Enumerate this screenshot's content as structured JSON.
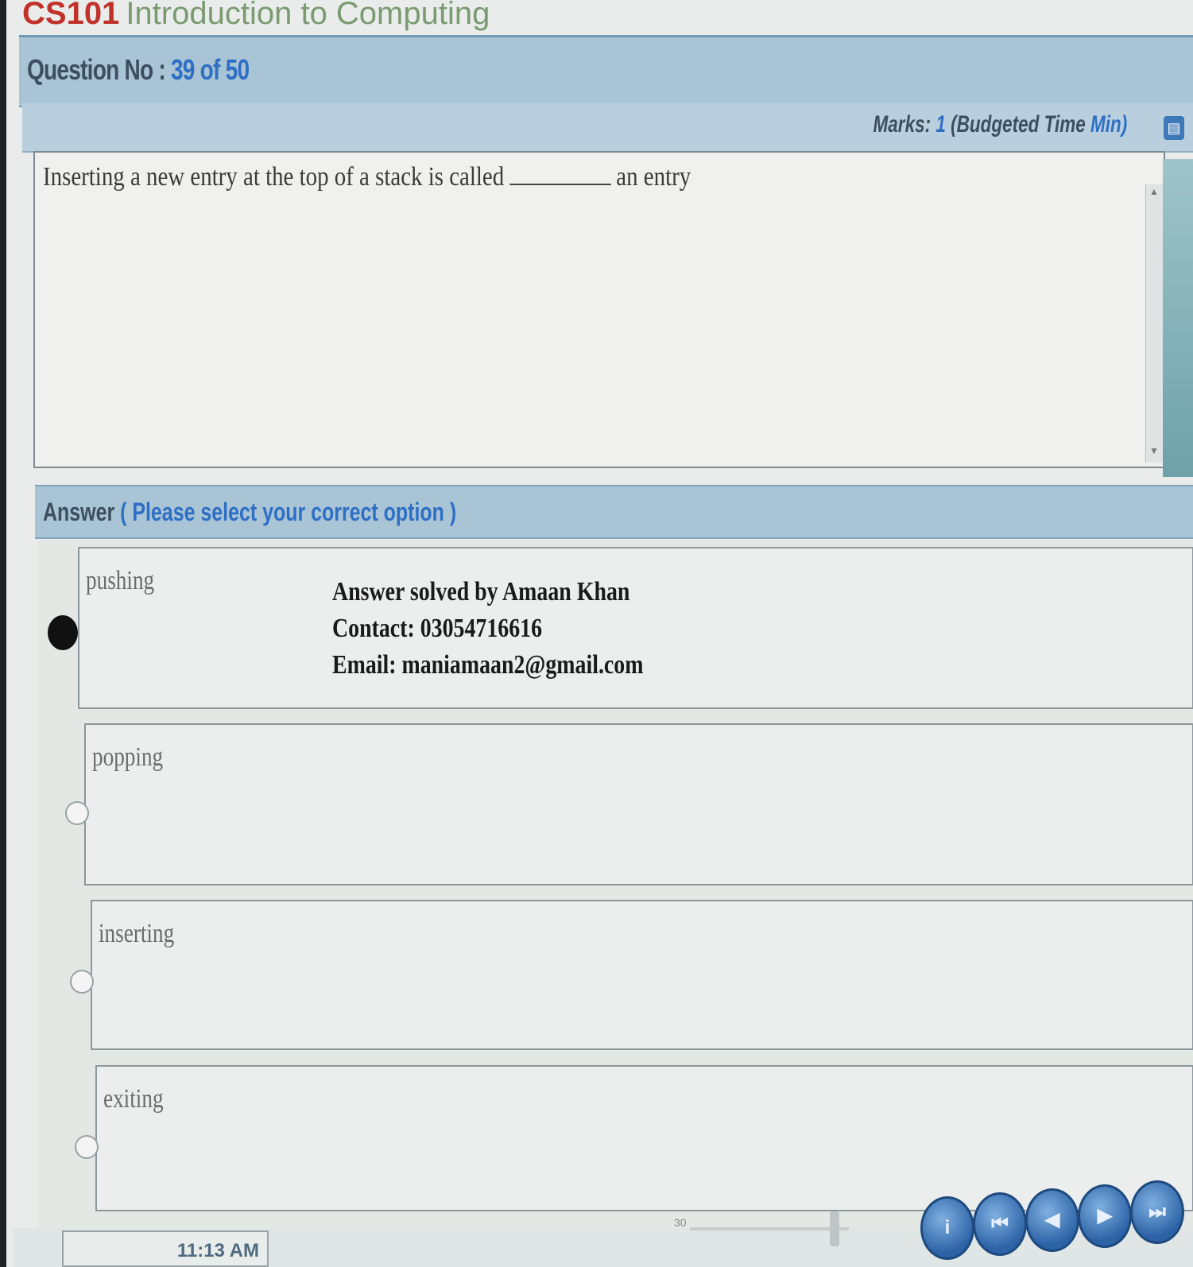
{
  "header": {
    "course_code": "CS101",
    "course_title": "Introduction to Computing",
    "question_label": "Question No :",
    "question_number": "39 of 50",
    "marks_label": "Marks:",
    "marks_value": "1",
    "budgeted_time_label": "(Budgeted Time",
    "budgeted_time_unit": "Min)"
  },
  "question": {
    "text_before_blank": "Inserting a new entry at the top of a stack is called",
    "text_after_blank": "an entry"
  },
  "answer": {
    "label": "Answer",
    "hint": "( Please select your correct option )",
    "options": [
      {
        "label": "pushing",
        "selected": true
      },
      {
        "label": "popping",
        "selected": false
      },
      {
        "label": "inserting",
        "selected": false
      },
      {
        "label": "exiting",
        "selected": false
      }
    ]
  },
  "watermark": {
    "line1": "Answer solved by Amaan Khan",
    "line2": "Contact: 03054716616",
    "line3": "Email: maniamaan2@gmail.com"
  },
  "footer": {
    "time_text": "11:13 AM",
    "slider_value": "30",
    "nav_buttons": [
      "info-icon",
      "first-icon",
      "previous-icon",
      "next-icon",
      "last-icon"
    ],
    "nav_glyphs": [
      "i",
      "⏮",
      "◀",
      "▶",
      "⏭"
    ]
  },
  "colors": {
    "header_bar": "#a9c4d5",
    "accent_blue": "#2e6fc5",
    "title_red": "#c0322a"
  }
}
